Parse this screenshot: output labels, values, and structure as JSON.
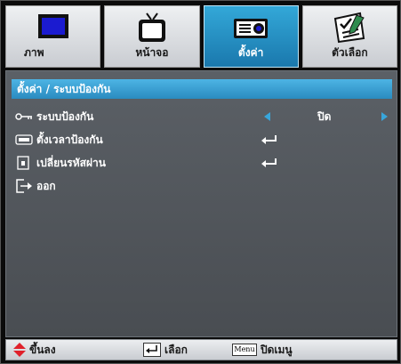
{
  "tabs": [
    {
      "label": "ภาพ",
      "icon": "monitor-icon",
      "active": false
    },
    {
      "label": "หน้าจอ",
      "icon": "tv-icon",
      "active": false
    },
    {
      "label": "ตั้งค่า",
      "icon": "projector-icon",
      "active": true
    },
    {
      "label": "ตัวเลือก",
      "icon": "checklist-icon",
      "active": false
    }
  ],
  "section_title": "ตั้งค่า / ระบบป้องกัน",
  "rows": [
    {
      "label": "ระบบป้องกัน",
      "icon": "key-icon",
      "value": "ปิด"
    },
    {
      "label": "ตั้งเวลาป้องกัน",
      "icon": "timer-icon"
    },
    {
      "label": "เปลี่ยนรหัสผ่าน",
      "icon": "password-icon"
    },
    {
      "label": "ออก",
      "icon": "exit-icon"
    }
  ],
  "bottom_bar": {
    "updown_label": "ขึ้นลง",
    "select_label": "เลือก",
    "menu_key": "Menu",
    "close_label": "ปิดเมนู"
  },
  "colors": {
    "accent": "#2a8bc0",
    "panel": "#50555a",
    "arrow": "#38a6db",
    "nav_arrows": "#e0202a"
  }
}
